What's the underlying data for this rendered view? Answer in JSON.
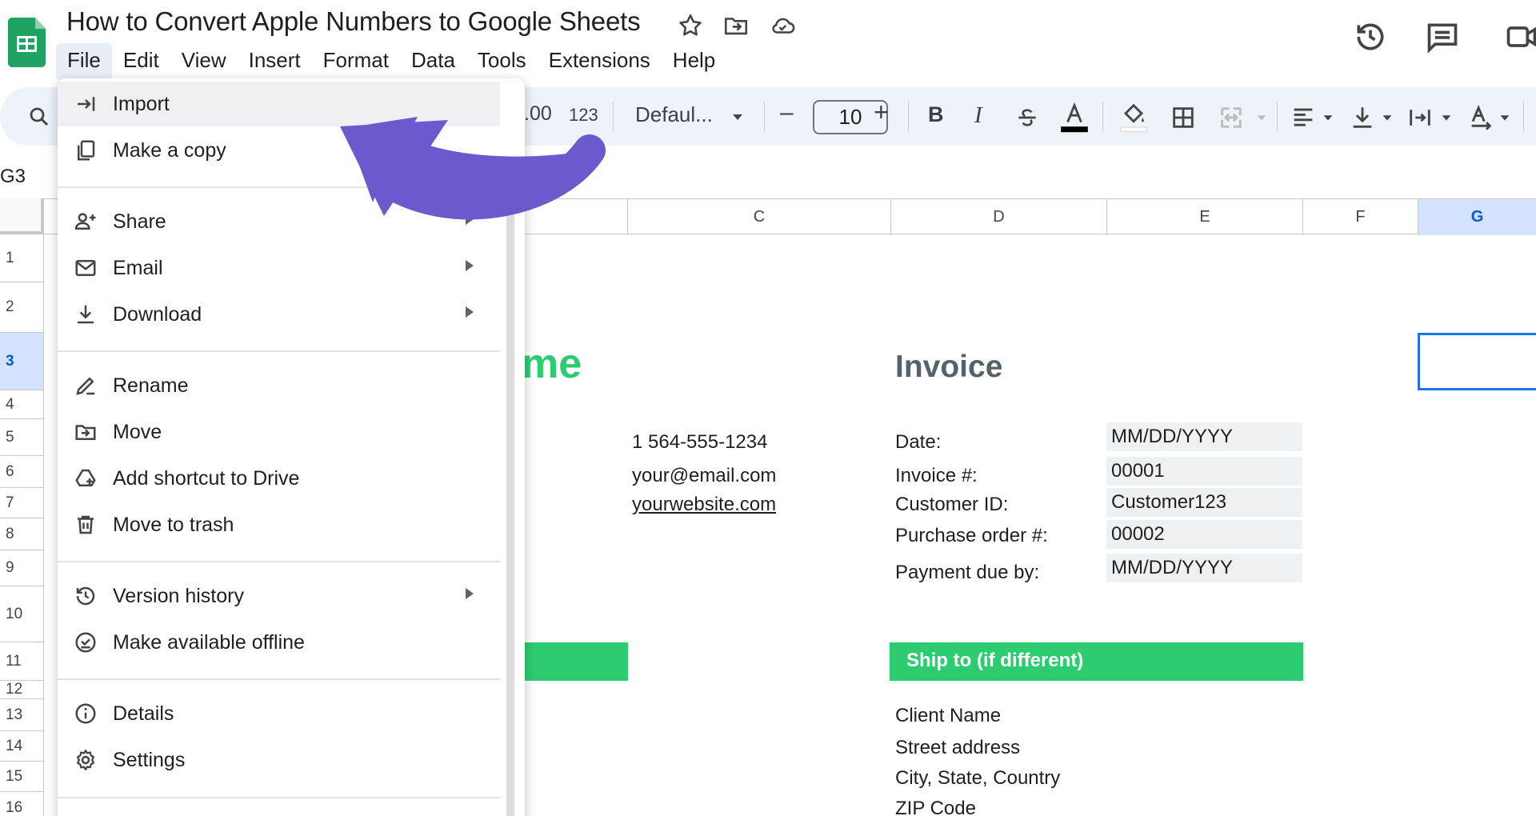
{
  "app": {
    "title": "How to Convert Apple Numbers to Google Sheets"
  },
  "menubar": [
    "File",
    "Edit",
    "View",
    "Insert",
    "Format",
    "Data",
    "Tools",
    "Extensions",
    "Help"
  ],
  "toolbar": {
    "decimal_label": ".00",
    "number_format_label": "123",
    "font_name": "Defaul...",
    "font_size": "10",
    "minus_label": "–",
    "plus_label": "+",
    "bold_label": "B",
    "italic_label": "I"
  },
  "name_box": "G3",
  "columns": [
    "C",
    "D",
    "E",
    "F",
    "G"
  ],
  "rows": [
    "1",
    "2",
    "3",
    "4",
    "5",
    "6",
    "7",
    "8",
    "9",
    "10",
    "11",
    "12",
    "13",
    "14",
    "15",
    "16"
  ],
  "selected": {
    "column": "G",
    "row": "3"
  },
  "sheet": {
    "company_partial": "me",
    "invoice_title": "Invoice",
    "phone": "1 564-555-1234",
    "email": "your@email.com",
    "website": "yourwebsite.com",
    "fields": [
      {
        "label": "Date:",
        "value": "MM/DD/YYYY"
      },
      {
        "label": "Invoice #:",
        "value": "00001"
      },
      {
        "label": "Customer ID:",
        "value": "Customer123"
      },
      {
        "label": "Purchase order #:",
        "value": "00002"
      },
      {
        "label": "Payment due by:",
        "value": "MM/DD/YYYY"
      }
    ],
    "ship_to_header": "Ship to (if different)",
    "ship_to": [
      "Client Name",
      "Street address",
      "City, State, Country",
      "ZIP Code"
    ]
  },
  "file_menu": {
    "items": [
      {
        "label": "Import",
        "icon": "import-icon",
        "submenu": false
      },
      {
        "label": "Make a copy",
        "icon": "copy-icon",
        "submenu": false
      },
      {
        "label": "Share",
        "icon": "share-icon",
        "submenu": true
      },
      {
        "label": "Email",
        "icon": "email-icon",
        "submenu": true
      },
      {
        "label": "Download",
        "icon": "download-icon",
        "submenu": true
      },
      {
        "label": "Rename",
        "icon": "rename-icon",
        "submenu": false
      },
      {
        "label": "Move",
        "icon": "move-folder-icon",
        "submenu": false
      },
      {
        "label": "Add shortcut to Drive",
        "icon": "drive-shortcut-icon",
        "submenu": false
      },
      {
        "label": "Move to trash",
        "icon": "trash-icon",
        "submenu": false
      },
      {
        "label": "Version history",
        "icon": "history-icon",
        "submenu": true
      },
      {
        "label": "Make available offline",
        "icon": "offline-icon",
        "submenu": false
      },
      {
        "label": "Details",
        "icon": "info-icon",
        "submenu": false
      },
      {
        "label": "Settings",
        "icon": "gear-icon",
        "submenu": false
      }
    ],
    "highlighted": "Import"
  },
  "colors": {
    "brand_green": "#2ecc71",
    "sheets_green": "#1ea362",
    "annotation_arrow": "#6a5acd",
    "selection_blue": "#1a73e8",
    "toolbar_bg": "#eef2f9"
  }
}
